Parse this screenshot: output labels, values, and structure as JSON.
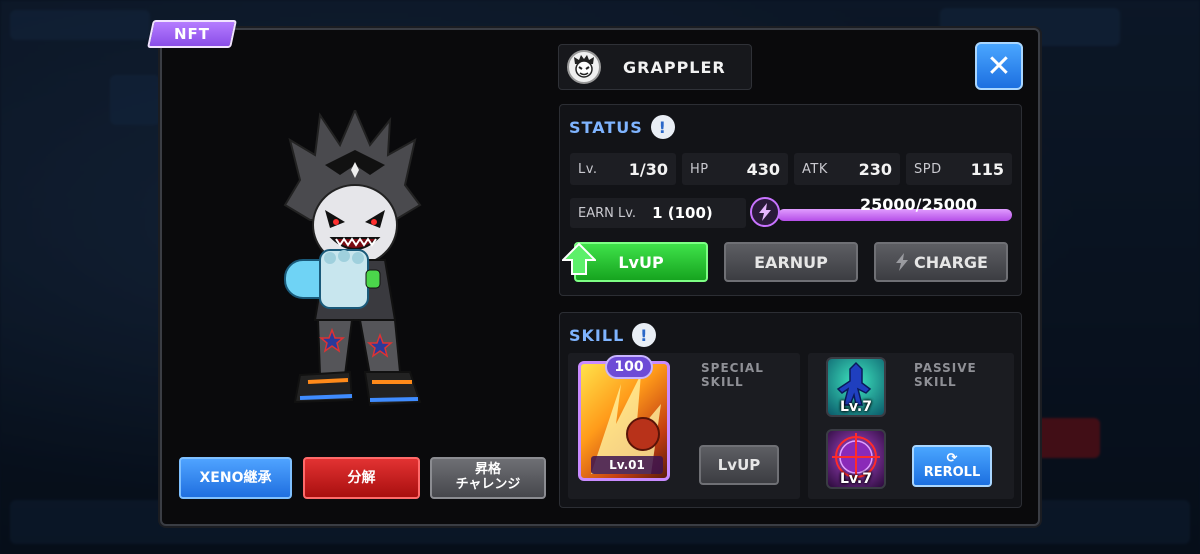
{
  "modal": {
    "nft_label": "NFT",
    "class_name": "GRAPPLER",
    "close_symbol": "✕"
  },
  "actions": {
    "xeno_label": "XENO継承",
    "bunkai_label": "分解",
    "shokaku_label_1": "昇格",
    "shokaku_label_2": "チャレンジ"
  },
  "status": {
    "title": "STATUS",
    "info": "!",
    "level_label": "Lv.",
    "level_value": "1/30",
    "hp_label": "HP",
    "hp_value": "430",
    "atk_label": "ATK",
    "atk_value": "230",
    "spd_label": "SPD",
    "spd_value": "115",
    "earn_label": "EARN Lv.",
    "earn_value": "1 (100)",
    "stamina_text": "25000/25000",
    "stamina_fraction": 1.0,
    "lvup_label": "LvUP",
    "earnup_label": "EARNUP",
    "charge_label": "CHARGE"
  },
  "skill": {
    "title": "SKILL",
    "info": "!",
    "card_badge": "100",
    "card_level": "Lv.01",
    "special_label_1": "SPECIAL",
    "special_label_2": "SKILL",
    "special_lvup": "LvUP",
    "passive_label_1": "PASSIVE",
    "passive_label_2": "SKILL",
    "passive_1_level": "Lv.7",
    "passive_2_level": "Lv.7",
    "reroll_symbol": "⟳",
    "reroll_label": "REROLL"
  },
  "colors": {
    "accent_blue": "#1c6fe0",
    "lvup_green": "#16a41f",
    "danger_red": "#a90f0f",
    "nft_purple": "#8a4de8",
    "stamina_purple": "#b54ee8"
  },
  "icons": {
    "class": "grappler-face-icon",
    "close": "close-icon",
    "bolt": "bolt-icon",
    "lvup": "up-arrow-icon",
    "reroll": "refresh-icon"
  }
}
